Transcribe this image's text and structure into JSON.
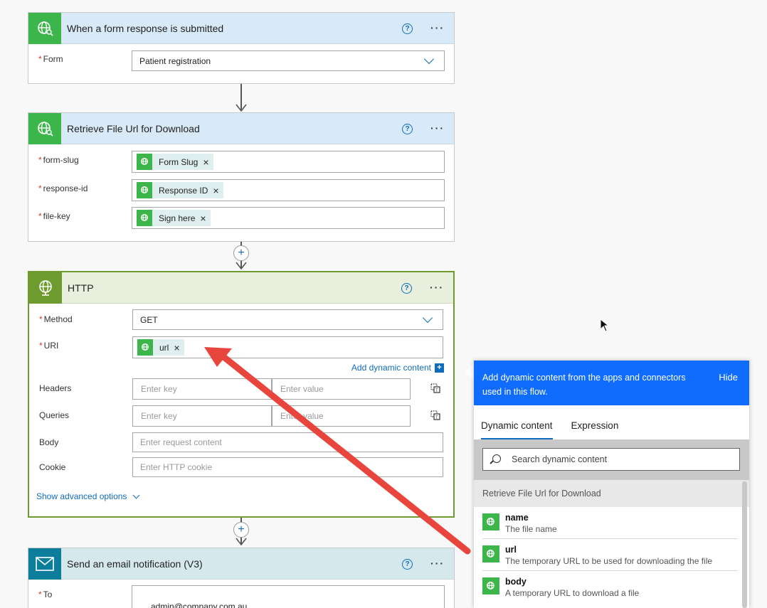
{
  "card1": {
    "title": "When a form response is submitted",
    "help": "?",
    "more": "···",
    "form_label": "Form",
    "form_value": "Patient registration"
  },
  "card2": {
    "title": "Retrieve File Url for Download",
    "help": "?",
    "more": "···",
    "fields": [
      {
        "label": "form-slug",
        "token": "Form Slug"
      },
      {
        "label": "response-id",
        "token": "Response ID"
      },
      {
        "label": "file-key",
        "token": "Sign here"
      }
    ]
  },
  "http": {
    "title": "HTTP",
    "help": "?",
    "more": "···",
    "method_label": "Method",
    "method_value": "GET",
    "uri_label": "URI",
    "uri_token": "url",
    "add_dynamic": "Add dynamic content",
    "headers_label": "Headers",
    "queries_label": "Queries",
    "body_label": "Body",
    "cookie_label": "Cookie",
    "key_placeholder": "Enter key",
    "value_placeholder": "Enter value",
    "body_placeholder": "Enter request content",
    "cookie_placeholder": "Enter HTTP cookie",
    "advanced": "Show advanced options"
  },
  "email": {
    "title": "Send an email notification (V3)",
    "help": "?",
    "more": "···",
    "to_label": "To",
    "to_value": "admin@company.com.au"
  },
  "panel": {
    "header_text": "Add dynamic content from the apps and connectors used in this flow.",
    "hide": "Hide",
    "tab_dynamic": "Dynamic content",
    "tab_expression": "Expression",
    "search_placeholder": "Search dynamic content",
    "section": "Retrieve File Url for Download",
    "items": [
      {
        "name": "name",
        "desc": "The file name"
      },
      {
        "name": "url",
        "desc": "The temporary URL to be used for downloading the file"
      },
      {
        "name": "body",
        "desc": "A temporary URL to download a file"
      }
    ]
  },
  "colors": {
    "accent_blue": "#0f6cbd",
    "panel_blue": "#0f6cfd",
    "forms_green": "#3cb54a",
    "http_green": "#6d9b2e",
    "email_teal": "#0d7d9c",
    "annotation_red": "#e8453c"
  }
}
